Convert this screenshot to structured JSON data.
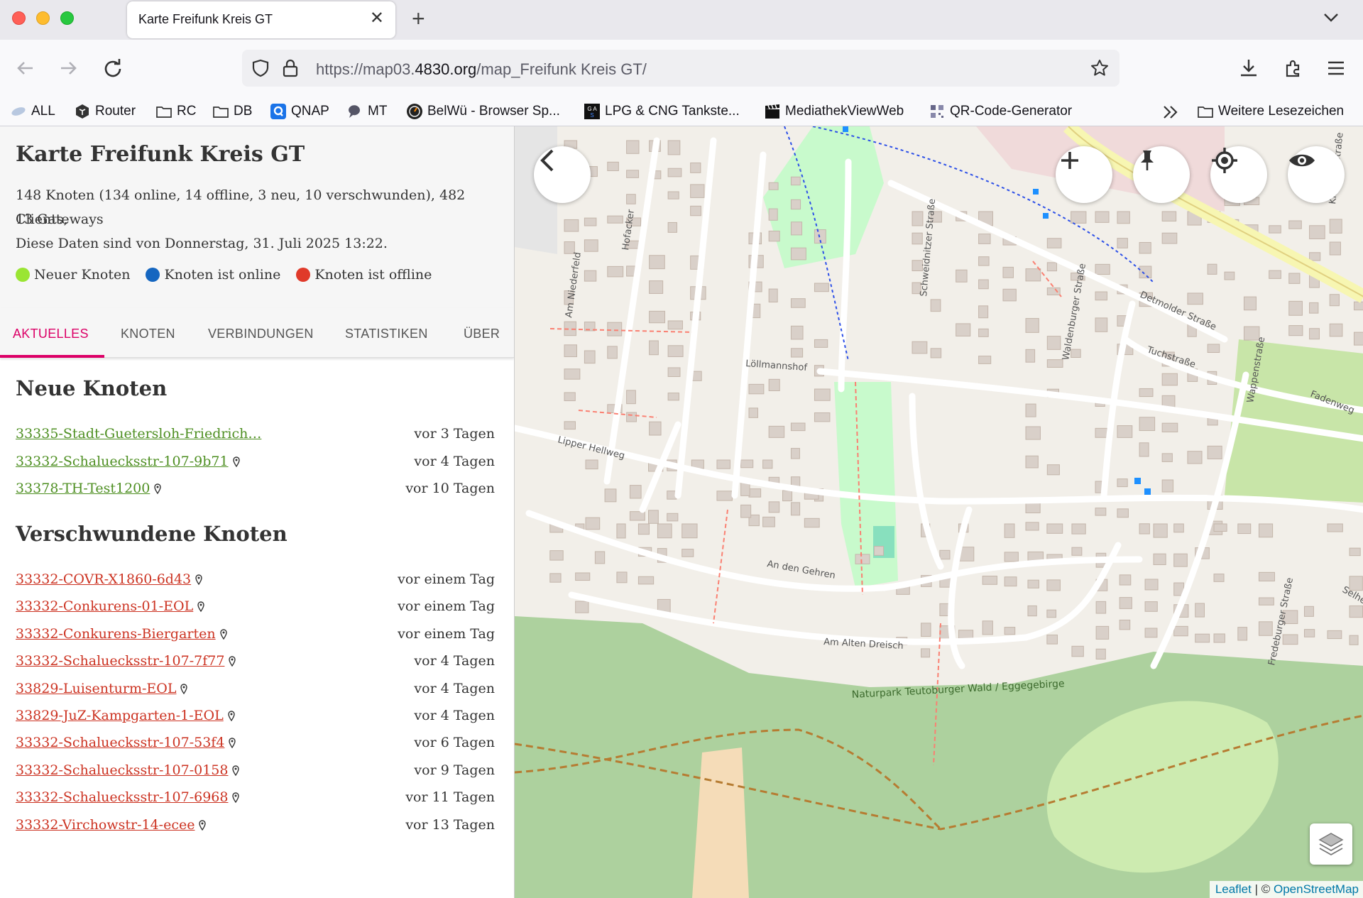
{
  "browser": {
    "tab_title": "Karte Freifunk Kreis GT",
    "url_prefix": "https://map03.",
    "url_domain": "4830.org",
    "url_path": "/map_Freifunk Kreis GT/",
    "bookmarks": [
      {
        "label": "ALL",
        "icon": "bookmark-icon"
      },
      {
        "label": "Router",
        "icon": "router-icon"
      },
      {
        "label": "RC",
        "icon": "folder-icon"
      },
      {
        "label": "DB",
        "icon": "folder-icon"
      },
      {
        "label": "QNAP",
        "icon": "qnap-icon"
      },
      {
        "label": "MT",
        "icon": "chat-icon"
      },
      {
        "label": "BelWü - Browser Sp...",
        "icon": "gauge-icon"
      },
      {
        "label": "LPG & CNG Tankste...",
        "icon": "gas-icon"
      },
      {
        "label": "MediathekViewWeb",
        "icon": "clapper-icon"
      },
      {
        "label": "QR-Code-Generator",
        "icon": "qr-icon"
      }
    ],
    "other_bookmarks": "Weitere Lesezeichen"
  },
  "sidebar": {
    "title": "Karte Freifunk Kreis GT",
    "stats_line1": "148 Knoten (134 online, 14 offline, 3 neu, 10 verschwunden), 482 Clients,",
    "stats_line2": "13 Gateways",
    "date_line": "Diese Daten sind von Donnerstag, 31. Juli 2025 13:22.",
    "legend": [
      {
        "label": "Neuer Knoten",
        "color": "#9ae533"
      },
      {
        "label": "Knoten ist online",
        "color": "#1566c0"
      },
      {
        "label": "Knoten ist offline",
        "color": "#e03a2a"
      }
    ],
    "tabs": [
      "AKTUELLES",
      "KNOTEN",
      "VERBINDUNGEN",
      "STATISTIKEN",
      "ÜBER"
    ],
    "new_nodes_title": "Neue Knoten",
    "new_nodes": [
      {
        "name": "33335-Stadt-Guetersloh-Friedrich…",
        "when": "vor 3 Tagen",
        "pin": false
      },
      {
        "name": "33332-Schaluecksstr-107-9b71",
        "when": "vor 4 Tagen",
        "pin": true
      },
      {
        "name": "33378-TH-Test1200",
        "when": "vor 10 Tagen",
        "pin": true
      }
    ],
    "gone_nodes_title": "Verschwundene Knoten",
    "gone_nodes": [
      {
        "name": "33332-COVR-X1860-6d43",
        "when": "vor einem Tag"
      },
      {
        "name": "33332-Conkurens-01-EOL",
        "when": "vor einem Tag"
      },
      {
        "name": "33332-Conkurens-Biergarten",
        "when": "vor einem Tag"
      },
      {
        "name": "33332-Schaluecksstr-107-7f77",
        "when": "vor 4 Tagen"
      },
      {
        "name": "33829-Luisenturm-EOL",
        "when": "vor 4 Tagen"
      },
      {
        "name": "33829-JuZ-Kampgarten-1-EOL",
        "when": "vor 4 Tagen"
      },
      {
        "name": "33332-Schaluecksstr-107-53f4",
        "when": "vor 6 Tagen"
      },
      {
        "name": "33332-Schaluecksstr-107-0158",
        "when": "vor 9 Tagen"
      },
      {
        "name": "33332-Schaluecksstr-107-6968",
        "when": "vor 11 Tagen"
      },
      {
        "name": "33332-Virchowstr-14-ecee",
        "when": "vor 13 Tagen"
      }
    ]
  },
  "map": {
    "streets": [
      "Detmolder Straße",
      "Schweidnitzer Straße",
      "Waldenburger Straße",
      "Tuchstraße",
      "Löllmannshof",
      "Hofacker",
      "Am Niederfeld",
      "Lipper Hellweg",
      "An den Gehren",
      "Am Alten Dreisch",
      "Wappenstraße",
      "Fadenweg",
      "Fredeburger Straße",
      "Kistriner Straße",
      "Selhe",
      "Naturpark Teutoburger Wald / Eggegebirge"
    ],
    "attribution_leaflet": "Leaflet",
    "attribution_sep": " | © ",
    "attribution_osm": "OpenStreetMap"
  }
}
